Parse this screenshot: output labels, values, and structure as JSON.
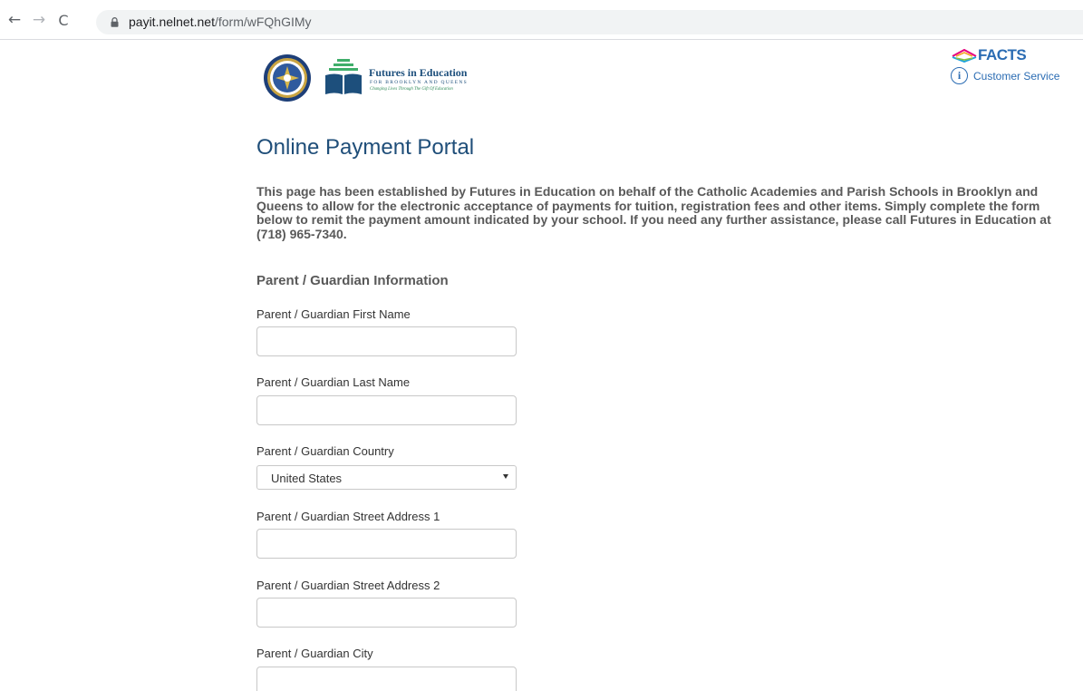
{
  "browser": {
    "url_host": "payit.nelnet.net",
    "url_path": "/form/wFQhGIMy",
    "back_icon": "arrow-left-icon",
    "forward_icon": "arrow-right-icon",
    "reload_icon": "reload-icon",
    "lock_icon": "lock-icon"
  },
  "header": {
    "org_name": "Futures in Education",
    "org_subtitle": "FOR BROOKLYN AND QUEENS",
    "org_tagline": "Changing Lives Through The Gift Of Education",
    "facts_brand": "FACTS",
    "customer_service_label": "Customer Service"
  },
  "main": {
    "title": "Online Payment Portal",
    "intro": "This page has been established by Futures in Education on behalf of the Catholic Academies and Parish Schools in Brooklyn and Queens to allow for the electronic acceptance of payments for tuition, registration fees and other items. Simply complete the form below to remit the payment amount indicated by your school. If you need any further assistance, please call Futures in Education at (718) 965-7340.",
    "section_heading": "Parent / Guardian Information",
    "fields": {
      "first_name": {
        "label": "Parent / Guardian First Name",
        "value": ""
      },
      "last_name": {
        "label": "Parent / Guardian Last Name",
        "value": ""
      },
      "country": {
        "label": "Parent / Guardian Country",
        "value": "United States"
      },
      "street1": {
        "label": "Parent / Guardian Street Address 1",
        "value": ""
      },
      "street2": {
        "label": "Parent / Guardian Street Address 2",
        "value": ""
      },
      "city": {
        "label": "Parent / Guardian City",
        "value": ""
      }
    }
  },
  "colors": {
    "title_blue": "#1f4e79",
    "link_blue": "#2b6cb3",
    "body_gray": "#595959",
    "input_border": "#c8c8c8"
  }
}
